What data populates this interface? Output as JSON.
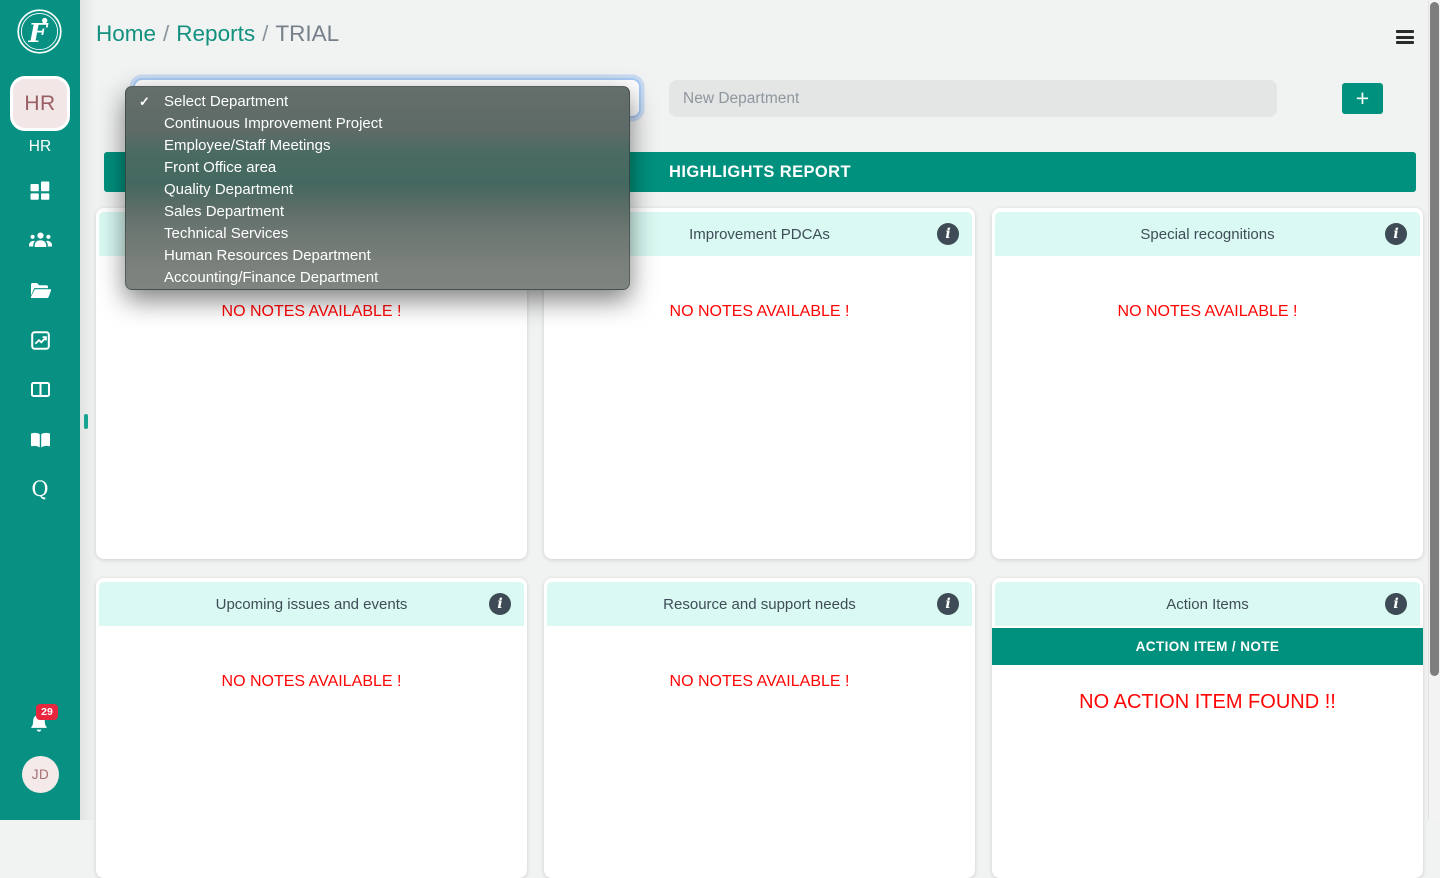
{
  "sidebar": {
    "workspace_tile": "HR",
    "workspace_label": "HR",
    "notification_count": "29",
    "user_initials": "JD"
  },
  "header": {
    "breadcrumb": {
      "home": "Home",
      "sep1": "/",
      "reports": "Reports",
      "sep2": "/",
      "current": "TRIAL"
    }
  },
  "controls": {
    "department_select": {
      "value": "Select Department"
    },
    "new_department": {
      "placeholder": "New Department"
    },
    "add_button": "+"
  },
  "dropdown": {
    "checkmark": "✓",
    "items": [
      "Select Department",
      "Continuous Improvement Project",
      "Employee/Staff Meetings",
      "Front Office area",
      "Quality Department",
      "Sales Department",
      "Technical Services",
      "Human Resources Department",
      "Accounting/Finance Department"
    ]
  },
  "report": {
    "banner": "HIGHLIGHTS REPORT",
    "cards": [
      {
        "title": "",
        "empty_text": "NO NOTES AVAILABLE !"
      },
      {
        "title": "Improvement PDCAs",
        "empty_text": "NO NOTES AVAILABLE !"
      },
      {
        "title": "Special recognitions",
        "empty_text": "NO NOTES AVAILABLE !"
      },
      {
        "title": "Upcoming issues and events",
        "empty_text": "NO NOTES AVAILABLE !"
      },
      {
        "title": "Resource and support needs",
        "empty_text": "NO NOTES AVAILABLE !"
      },
      {
        "title": "Action Items",
        "subheader": "ACTION ITEM / NOTE",
        "empty_text": "NO ACTION ITEM FOUND !!"
      }
    ]
  },
  "colors": {
    "sidebar_teal": "#089183",
    "banner_teal": "#00917E",
    "card_header_cyan": "#D9F9F2",
    "alert_red": "#FF0505",
    "badge_red": "#E8273F",
    "link_teal": "#12917F"
  }
}
